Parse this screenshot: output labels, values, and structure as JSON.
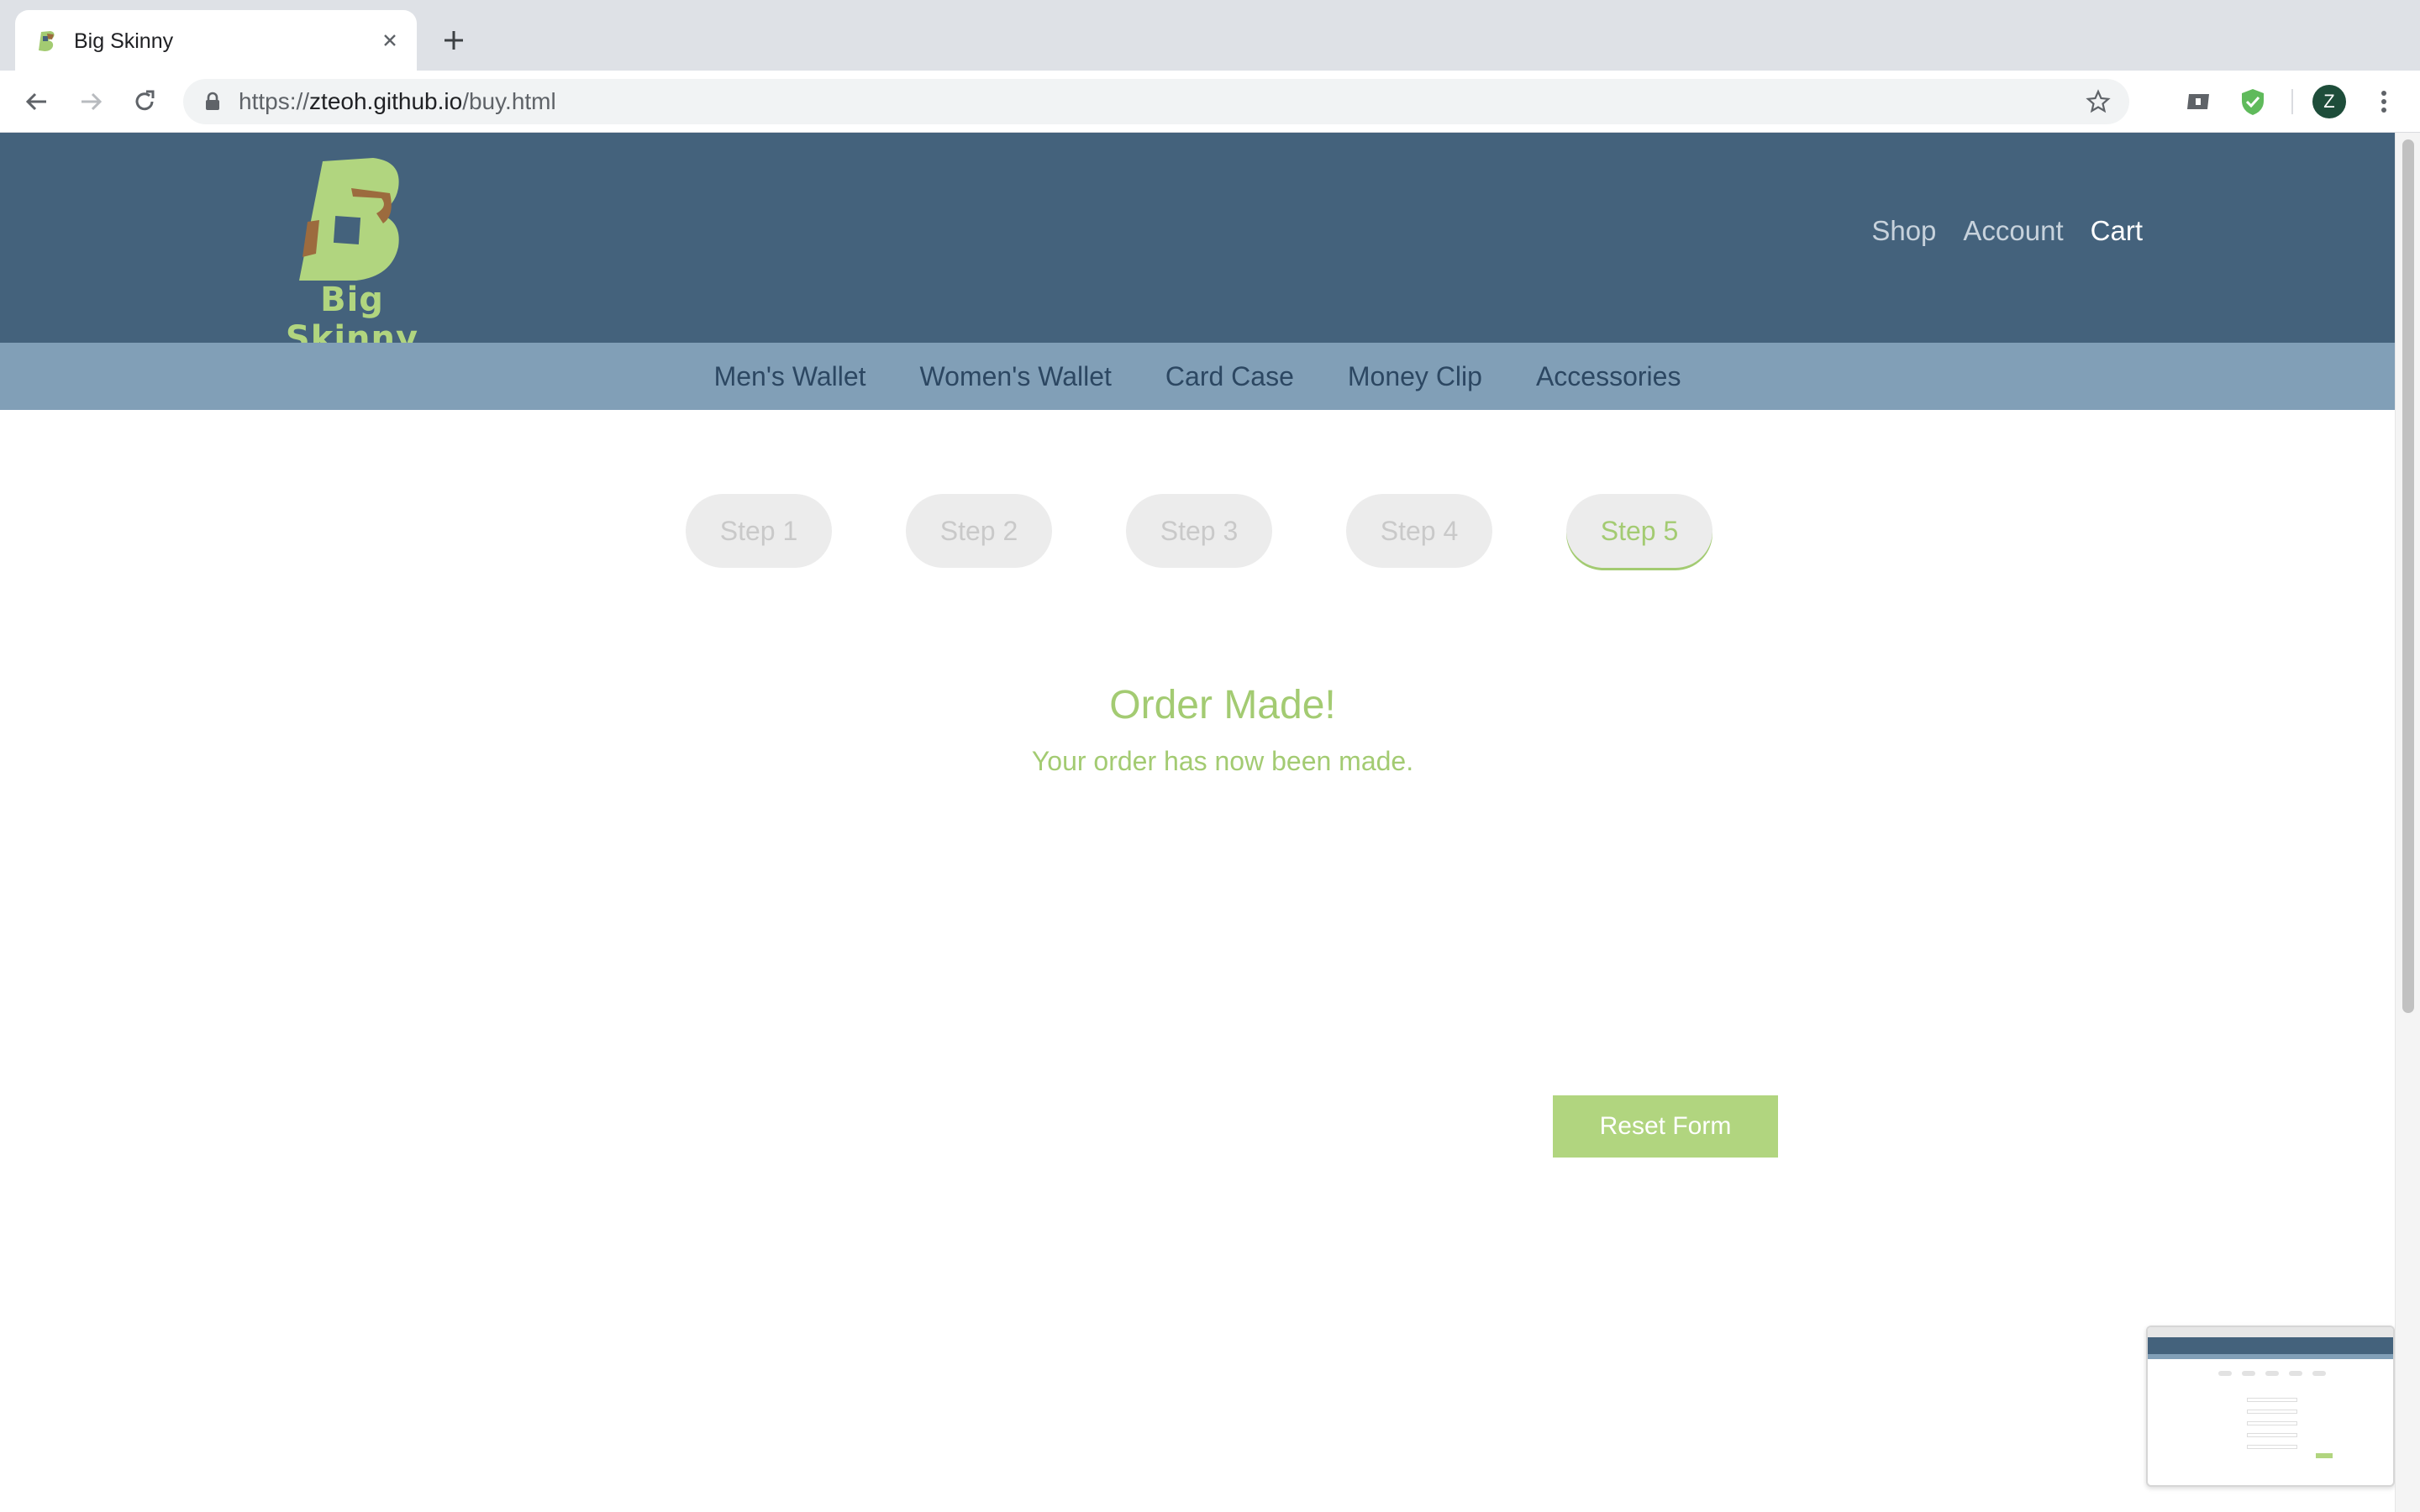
{
  "browser": {
    "tab_title": "Big Skinny",
    "url_scheme": "https://",
    "url_host": "zteoh.github.io",
    "url_path": "/buy.html",
    "profile_initial": "Z"
  },
  "site": {
    "logo_text": "Big Skinny",
    "header_links": [
      "Shop",
      "Account",
      "Cart"
    ],
    "active_header_link": "Cart",
    "categories": [
      "Men's Wallet",
      "Women's Wallet",
      "Card Case",
      "Money Clip",
      "Accessories"
    ]
  },
  "checkout": {
    "steps": [
      "Step 1",
      "Step 2",
      "Step 3",
      "Step 4",
      "Step 5"
    ],
    "current_step": "Step 5",
    "title": "Order Made!",
    "message": "Your order has now been made.",
    "reset_label": "Reset Form"
  },
  "colors": {
    "header_bg": "#44627c",
    "nav_bg": "#819fb7",
    "accent_green": "#a3cb72",
    "button_green": "#b1d57f",
    "step_bg": "#ececec"
  },
  "icons": [
    "favicon-icon",
    "close-icon",
    "plus-icon",
    "back-arrow-icon",
    "forward-arrow-icon",
    "reload-icon",
    "lock-icon",
    "star-icon",
    "extension-icon",
    "shield-check-icon",
    "more-vert-icon"
  ]
}
